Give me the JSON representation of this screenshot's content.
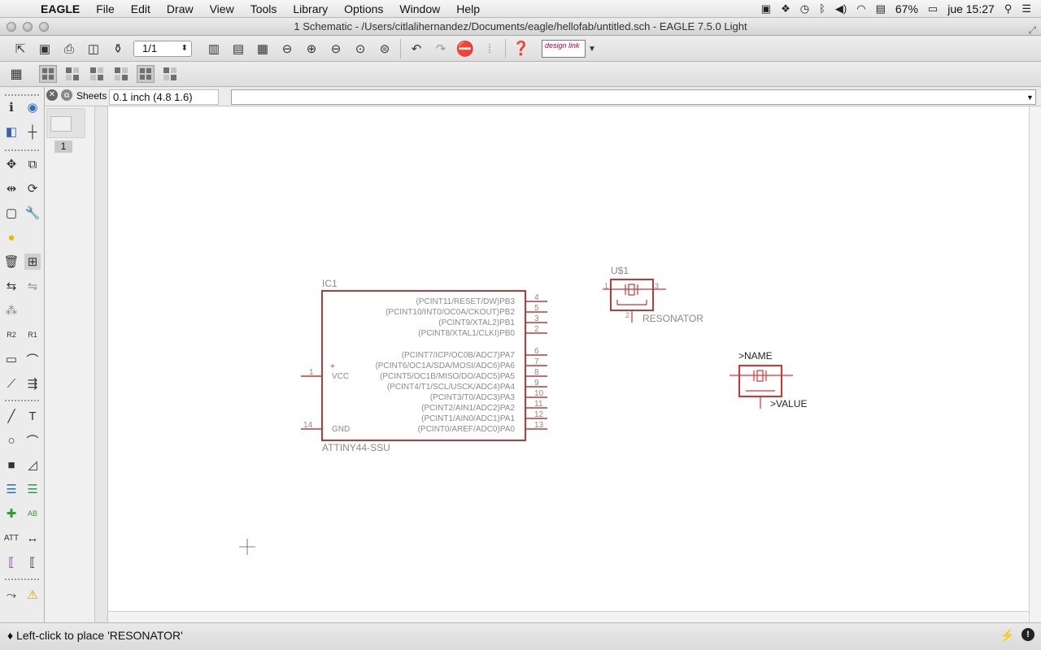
{
  "menubar": {
    "apple_glyph": "",
    "app_name": "EAGLE",
    "items": [
      "File",
      "Edit",
      "Draw",
      "View",
      "Tools",
      "Library",
      "Options",
      "Window",
      "Help"
    ],
    "battery": "67%",
    "clock": "jue 15:27"
  },
  "window": {
    "title": "1 Schematic - /Users/citlalihernandez/Documents/eagle/hellofab/untitled.sch - EAGLE 7.5.0 Light"
  },
  "toolbar": {
    "sheet_value": "1/1",
    "designlink_label": "design link"
  },
  "command": {
    "sheets_label": "Sheets",
    "coordinates": "0.1 inch (4.8 1.6)",
    "input_value": ""
  },
  "sheets": {
    "items": [
      {
        "number": "1"
      }
    ]
  },
  "schematic": {
    "ic": {
      "name": "IC1",
      "value": "ATTINY44-SSU",
      "left_pins": [
        {
          "num": "1",
          "label": "VCC",
          "symbol": "+"
        },
        {
          "num": "14",
          "label": "GND"
        }
      ],
      "right_pins": [
        {
          "num": "4",
          "label": "(PCINT11/RESET/DW)PB3"
        },
        {
          "num": "5",
          "label": "(PCINT10/INT0/OC0A/CKOUT)PB2"
        },
        {
          "num": "3",
          "label": "(PCINT9/XTAL2)PB1"
        },
        {
          "num": "2",
          "label": "(PCINT8/XTAL1/CLKI)PB0"
        },
        {
          "num": "6",
          "label": "(PCINT7/ICP/OC0B/ADC7)PA7"
        },
        {
          "num": "7",
          "label": "(PCINT6/OC1A/SDA/MOSI/ADC6)PA6"
        },
        {
          "num": "8",
          "label": "(PCINT5/OC1B/MISO/DO/ADC5)PA5"
        },
        {
          "num": "9",
          "label": "(PCINT4/T1/SCL/USCK/ADC4)PA4"
        },
        {
          "num": "10",
          "label": "(PCINT3/T0/ADC3)PA3"
        },
        {
          "num": "11",
          "label": "(PCINT2/AIN1/ADC2)PA2"
        },
        {
          "num": "12",
          "label": "(PCINT1/AIN0/ADC1)PA1"
        },
        {
          "num": "13",
          "label": "(PCINT0/AREF/ADC0)PA0"
        }
      ]
    },
    "resonator_placed": {
      "name": "U$1",
      "value": "RESONATOR",
      "pin_left": "1",
      "pin_right": "3",
      "pin_bottom": "2"
    },
    "resonator_ghost": {
      "name": ">NAME",
      "value": ">VALUE"
    }
  },
  "status": {
    "message": "♦ Left-click to place 'RESONATOR'"
  },
  "colors": {
    "symbol_red": "#b83a3a",
    "ghost_red": "#e03030",
    "text_gray": "#8a8a8a"
  }
}
